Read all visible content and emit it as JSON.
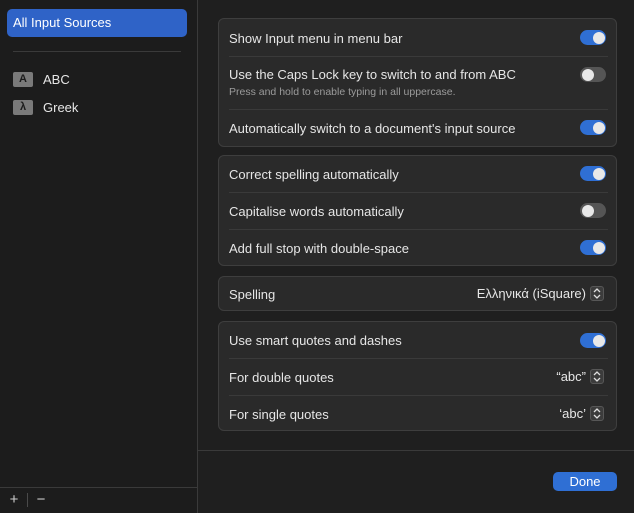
{
  "sidebar": {
    "selected_label": "All Input Sources",
    "sources": [
      {
        "icon_glyph": "A",
        "icon": "abc-keyboard-icon",
        "label": "ABC"
      },
      {
        "icon_glyph": "λ",
        "icon": "greek-keyboard-icon",
        "label": "Greek"
      }
    ],
    "add_label": "+",
    "remove_label": "−"
  },
  "groups": {
    "menu": {
      "show_input_menu": {
        "label": "Show Input menu in menu bar",
        "on": true
      },
      "caps_lock": {
        "label": "Use the Caps Lock key to switch to and from ABC",
        "sublabel": "Press and hold to enable typing in all uppercase.",
        "on": false
      },
      "auto_switch": {
        "label": "Automatically switch to a document's input source",
        "on": true
      }
    },
    "text": {
      "correct_spelling": {
        "label": "Correct spelling automatically",
        "on": true
      },
      "capitalise": {
        "label": "Capitalise words automatically",
        "on": false
      },
      "full_stop": {
        "label": "Add full stop with double-space",
        "on": true
      }
    },
    "spelling": {
      "label": "Spelling",
      "value": "Ελληνικά (iSquare)"
    },
    "quotes": {
      "smart_quotes": {
        "label": "Use smart quotes and dashes",
        "on": true
      },
      "double": {
        "label": "For double quotes",
        "value": "“abc”"
      },
      "single": {
        "label": "For single quotes",
        "value": "‘abc’"
      }
    }
  },
  "footer": {
    "done_label": "Done"
  },
  "colors": {
    "accent": "#2f6fd4",
    "selection": "#2f63c7",
    "background": "#1f1f1f",
    "group_background": "#2a2a2a"
  }
}
